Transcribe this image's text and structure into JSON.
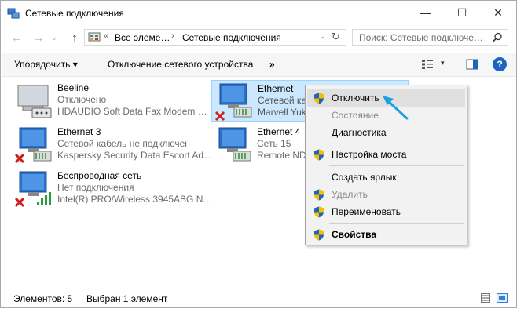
{
  "window": {
    "title": "Сетевые подключения",
    "controls": {
      "minimize": "—",
      "maximize": "☐",
      "close": "✕"
    }
  },
  "nav": {
    "back": "←",
    "forward": "→",
    "history": "⌄",
    "up": "↑",
    "address": {
      "chevron": "«",
      "segment1": "Все элеме…",
      "sep": "›",
      "segment2": "Сетевые подключения",
      "dropdown": "⌄",
      "refresh": "↻"
    },
    "search_placeholder": "Поиск: Сетевые подключе…"
  },
  "toolbar": {
    "organize": "Упорядочить ▾",
    "disable_device": "Отключение сетевого устройства",
    "more": "»",
    "view_dropdown": "▾",
    "help": "?"
  },
  "connections": [
    {
      "name": "Beeline",
      "status": "Отключено",
      "device": "HDAUDIO Soft Data Fax Modem …",
      "icon": "modem-icon",
      "selected": false
    },
    {
      "name": "Ethernet",
      "status": "Сетевой каб…",
      "device": "Marvell Yuk…",
      "icon": "ethernet-adapter-icon",
      "badge": "red-x",
      "selected": true
    },
    {
      "name": "Ethernet 3",
      "status": "Сетевой кабель не подключен",
      "device": "Kaspersky Security Data Escort Ad…",
      "icon": "ethernet-adapter-icon",
      "badge": "red-x",
      "selected": false
    },
    {
      "name": "Ethernet 4",
      "status": "Сеть  15",
      "device": "Remote ND…",
      "icon": "ethernet-adapter-icon",
      "selected": false
    },
    {
      "name": "Беспроводная сеть",
      "status": "Нет подключения",
      "device": "Intel(R) PRO/Wireless 3945ABG N…",
      "icon": "wifi-adapter-icon",
      "badge": "red-x",
      "selected": false
    }
  ],
  "context_menu": {
    "items": [
      {
        "label": "Отключить",
        "shield": true,
        "hover": true
      },
      {
        "label": "Состояние",
        "disabled": true
      },
      {
        "label": "Диагностика"
      },
      {
        "label": "Настройка моста",
        "shield": true
      },
      {
        "label": "Создать ярлык"
      },
      {
        "label": "Удалить",
        "shield": true,
        "disabled": true
      },
      {
        "label": "Переименовать",
        "shield": true
      },
      {
        "label": "Свойства",
        "shield": true,
        "bold": true
      }
    ]
  },
  "statusbar": {
    "count": "Элементов: 5",
    "selected": "Выбран 1 элемент"
  },
  "colors": {
    "selection": "#cce8ff",
    "selection_border": "#99d1ff",
    "accent_arrow": "#1ba1e2",
    "help": "#1d64c1",
    "error_x": "#d0201a"
  }
}
